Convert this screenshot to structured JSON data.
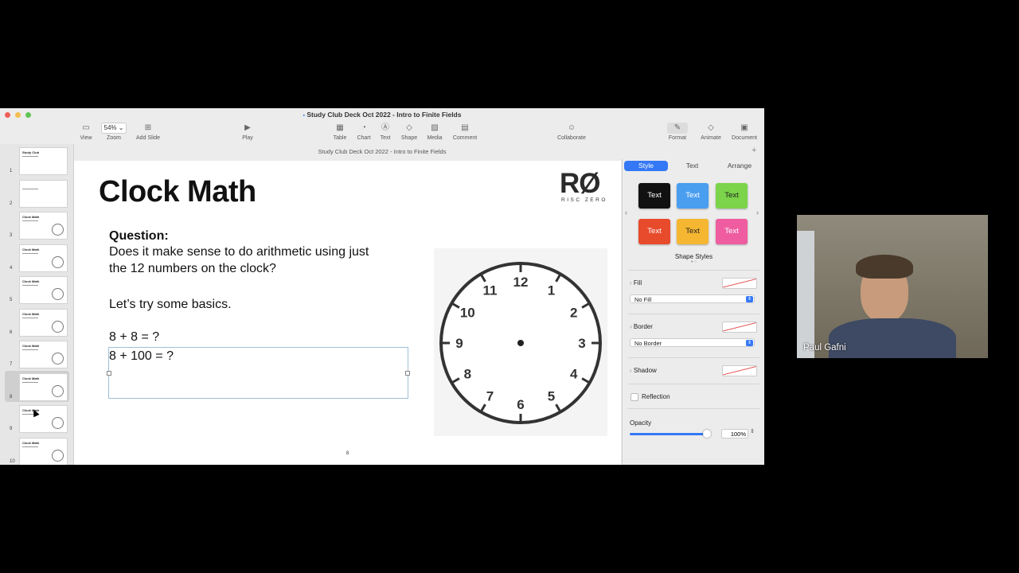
{
  "window": {
    "title": "Study Club Deck Oct 2022 - Intro to Finite Fields",
    "subtitle": "Study Club Deck Oct 2022 - Intro to Finite Fields"
  },
  "toolbar": {
    "view_label": "View",
    "zoom_value": "54%",
    "zoom_label": "Zoom",
    "add_slide_label": "Add Slide",
    "play_label": "Play",
    "table_label": "Table",
    "chart_label": "Chart",
    "text_label": "Text",
    "shape_label": "Shape",
    "media_label": "Media",
    "comment_label": "Comment",
    "collaborate_label": "Collaborate",
    "format_label": "Format",
    "animate_label": "Animate",
    "document_label": "Document"
  },
  "slides": [
    {
      "num": "1",
      "title": "Study Club"
    },
    {
      "num": "2",
      "title": ""
    },
    {
      "num": "3",
      "title": "Clock Math"
    },
    {
      "num": "4",
      "title": "Clock Math"
    },
    {
      "num": "5",
      "title": "Clock Math"
    },
    {
      "num": "6",
      "title": "Clock Math"
    },
    {
      "num": "7",
      "title": "Clock Math"
    },
    {
      "num": "8",
      "title": "Clock Math"
    },
    {
      "num": "9",
      "title": "Clock Math"
    },
    {
      "num": "10",
      "title": "Clock Math"
    }
  ],
  "slide": {
    "title": "Clock Math",
    "question_label": "Question:",
    "question_line1": "Does it make sense to do arithmetic using just",
    "question_line2": "the 12 numbers on the clock?",
    "basics": "Let’s try some basics.",
    "eq1": "8 + 8 = ?",
    "eq2": "8 + 100 = ?",
    "page_number": "8",
    "logo_main": "RØ",
    "logo_sub": "RISC ZERO",
    "clock_numbers": [
      "12",
      "1",
      "2",
      "3",
      "4",
      "5",
      "6",
      "7",
      "8",
      "9",
      "10",
      "11"
    ]
  },
  "inspector": {
    "tabs": [
      "Style",
      "Text",
      "Arrange"
    ],
    "style_buttons": [
      {
        "label": "Text",
        "color": "#111111"
      },
      {
        "label": "Text",
        "color": "#4a9ef0"
      },
      {
        "label": "Text",
        "color": "#7bd44a"
      },
      {
        "label": "Text",
        "color": "#e84a2c"
      },
      {
        "label": "Text",
        "color": "#f5b731"
      },
      {
        "label": "Text",
        "color": "#ef5da0"
      }
    ],
    "shape_styles_label": "Shape Styles",
    "fill_label": "Fill",
    "fill_value": "No Fill",
    "border_label": "Border",
    "border_value": "No Border",
    "shadow_label": "Shadow",
    "reflection_label": "Reflection",
    "opacity_label": "Opacity",
    "opacity_value": "100%",
    "opacity_fraction": 1.0
  },
  "video": {
    "participant_name": "Paul Gafni"
  }
}
